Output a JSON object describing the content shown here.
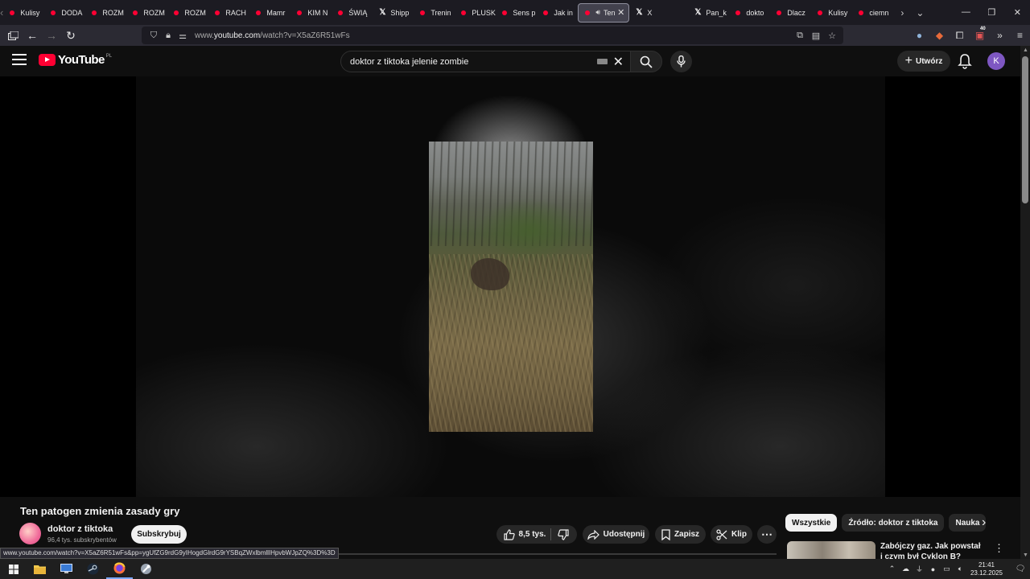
{
  "browser": {
    "tabs": [
      {
        "label": "Kulisy",
        "kind": "yt"
      },
      {
        "label": "DODA",
        "kind": "yt"
      },
      {
        "label": "ROZM",
        "kind": "yt"
      },
      {
        "label": "ROZM",
        "kind": "yt"
      },
      {
        "label": "ROZM",
        "kind": "yt"
      },
      {
        "label": "RACH",
        "kind": "yt"
      },
      {
        "label": "Mamr",
        "kind": "yt"
      },
      {
        "label": "KIM N",
        "kind": "yt"
      },
      {
        "label": "ŚWIĄ",
        "kind": "yt"
      },
      {
        "label": "Shipp",
        "kind": "x"
      },
      {
        "label": "Trenin",
        "kind": "yt"
      },
      {
        "label": "PLUSK",
        "kind": "yt"
      },
      {
        "label": "Sens p",
        "kind": "yt"
      },
      {
        "label": "Jak in",
        "kind": "yt"
      },
      {
        "label": "Ten",
        "kind": "yt-active"
      },
      {
        "label": "X",
        "kind": "x"
      },
      {
        "label": "Pan_k",
        "kind": "x"
      },
      {
        "label": "dokto",
        "kind": "yt"
      },
      {
        "label": "Dlacz",
        "kind": "yt"
      },
      {
        "label": "Kulisy",
        "kind": "yt"
      },
      {
        "label": "ciemn",
        "kind": "yt"
      }
    ],
    "url_prefix": "www.",
    "url_domain": "youtube.com",
    "url_rest": "/watch?v=X5aZ6R51wFs",
    "extension_badge": "40",
    "status_url": "www.youtube.com/watch?v=X5aZ6R51wFs&pp=ygUfZG9rdG9yIHogdGlrdG9rYSBqZWxlbmllIHpvbWJpZQ%3D%3D"
  },
  "youtube": {
    "logo_text": "YouTube",
    "country_code": "PL",
    "search_query": "doktor z tiktoka jelenie zombie",
    "create_label": "Utwórz",
    "avatar_letter": "K",
    "video": {
      "title": "Ten patogen zmienia zasady gry",
      "channel": "doktor z tiktoka",
      "subscribers": "96,4 tys. subskrybentów",
      "subscribe_label": "Subskrybuj",
      "likes": "8,5 tys.",
      "share_label": "Udostępnij",
      "save_label": "Zapisz",
      "clip_label": "Klip",
      "more_label": "⋯"
    },
    "chips": [
      "Wszystkie",
      "Źródło: doktor z tiktoka",
      "Nauka"
    ],
    "recommendation": {
      "title": "Zabójczy gaz. Jak powstał i czym był Cyklon B?"
    }
  },
  "taskbar": {
    "time": "21:41",
    "date": "23.12.2025"
  }
}
